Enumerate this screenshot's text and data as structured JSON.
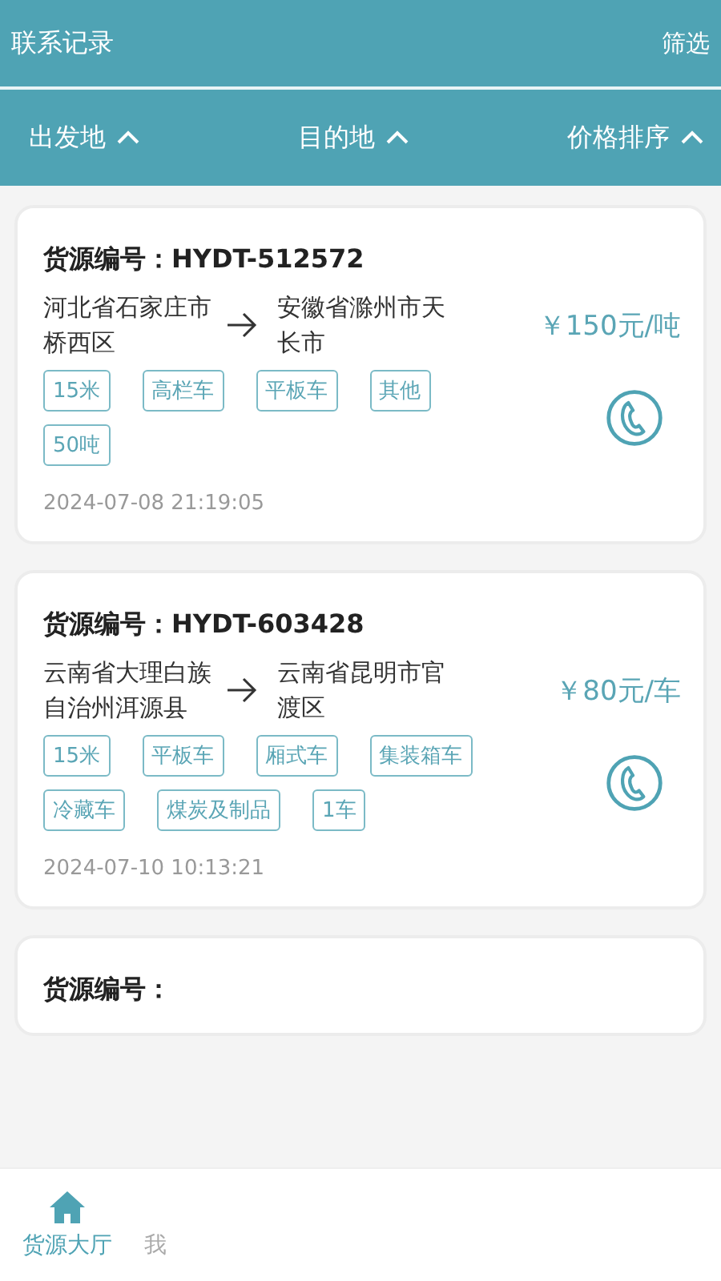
{
  "header": {
    "title": "联系记录",
    "action": "筛选"
  },
  "sort_bar": [
    {
      "label": "出发地",
      "expanded": true
    },
    {
      "label": "目的地",
      "expanded": true
    },
    {
      "label": "价格排序",
      "expanded": true
    }
  ],
  "cards": [
    {
      "number": "货源编号：HYDT-512572",
      "origin": "河北省石家庄市桥西区",
      "destination": "安徽省滁州市天长市",
      "price": "￥150元/吨",
      "tags": [
        "15米",
        "高栏车",
        "平板车",
        "其他",
        "50吨"
      ],
      "time": "2024-07-08 21:19:05"
    },
    {
      "number": "货源编号：HYDT-603428",
      "origin": "云南省大理白族自治州洱源县",
      "destination": "云南省昆明市官渡区",
      "price": "￥80元/车",
      "tags": [
        "15米",
        "平板车",
        "厢式车",
        "集装箱车",
        "冷藏车",
        "煤炭及制品",
        "1车"
      ],
      "time": "2024-07-10 10:13:21"
    },
    {
      "number": "货源编号："
    }
  ],
  "tab_bar": [
    {
      "label": "货源大厅",
      "selected": true
    },
    {
      "label": "我",
      "selected": false
    }
  ]
}
